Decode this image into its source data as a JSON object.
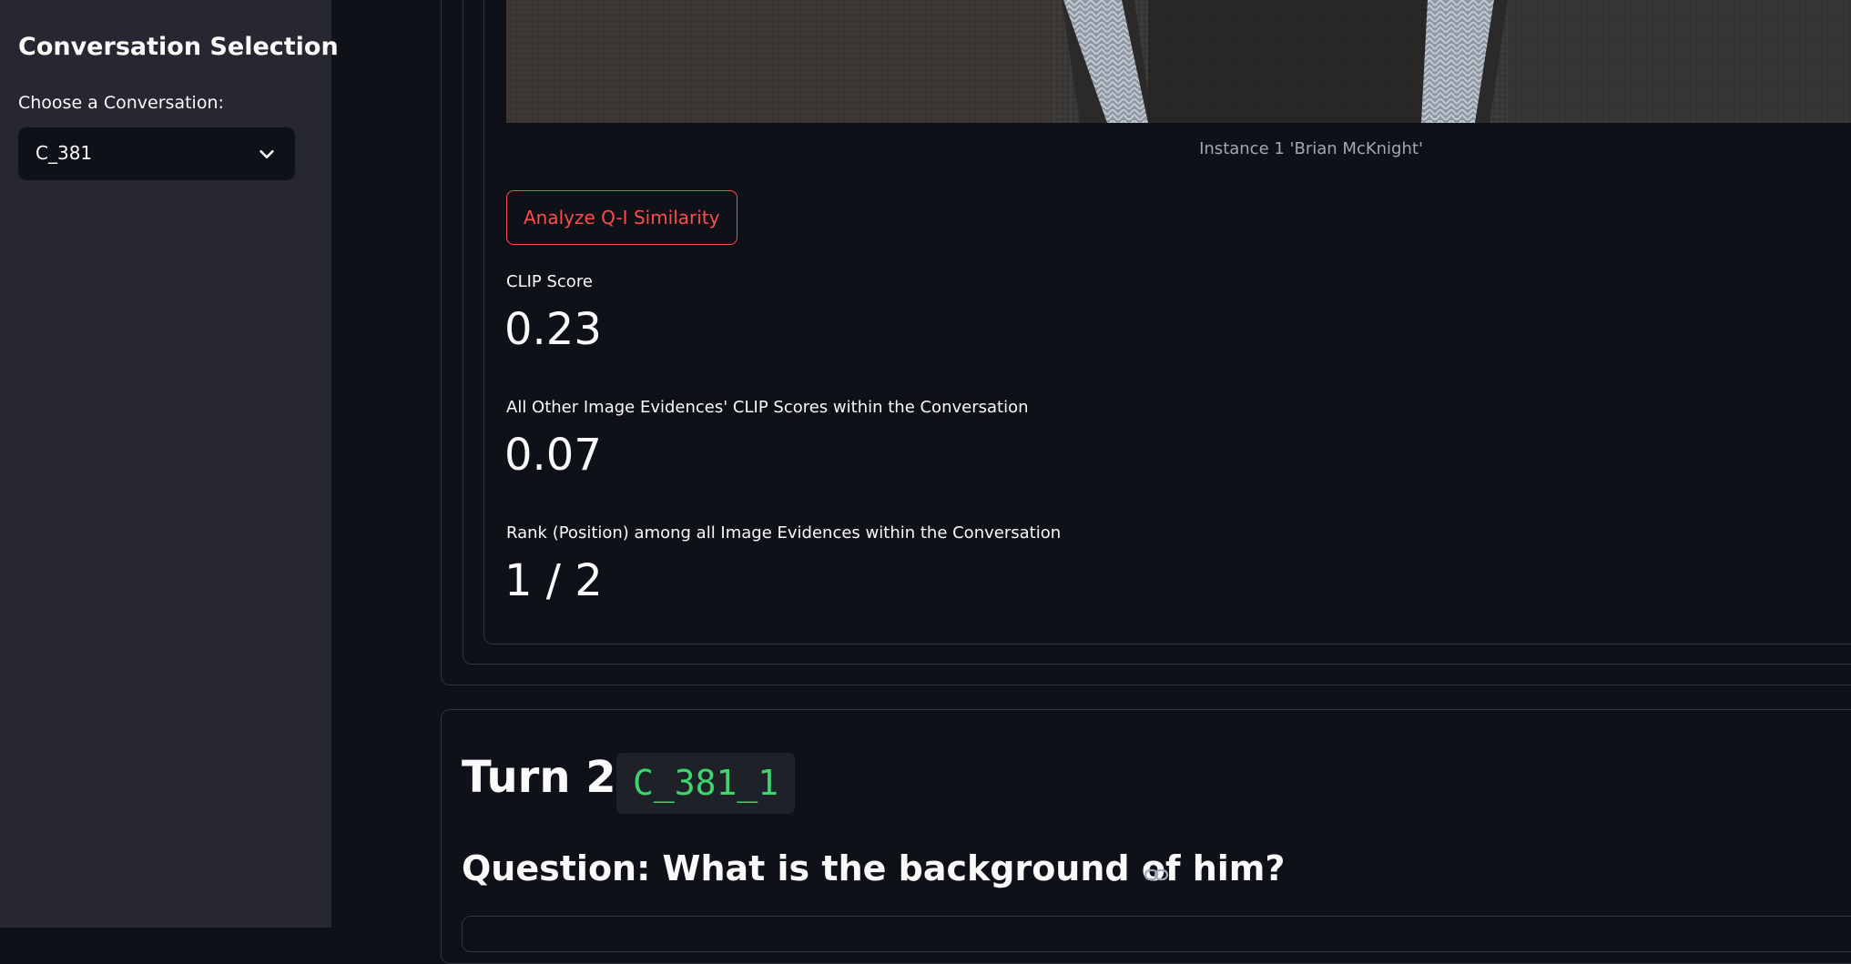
{
  "sidebar": {
    "title": "Conversation Selection",
    "select_label": "Choose a Conversation:",
    "selected_value": "C_381"
  },
  "image_evidence": {
    "caption": "Instance 1 'Brian McKnight'"
  },
  "analyze_button_label": "Analyze Q-I Similarity",
  "metrics": [
    {
      "label": "CLIP Score",
      "value": "0.23"
    },
    {
      "label": "All Other Image Evidences' CLIP Scores within the Conversation",
      "value": "0.07"
    },
    {
      "label": "Rank (Position) among all Image Evidences within the Conversation",
      "value": "1 / 2"
    }
  ],
  "turn": {
    "heading": "Turn 2:",
    "code": "C_381_1",
    "question": "Question: What is the background of him?"
  },
  "colors": {
    "background": "#0e1117",
    "sidebar": "#262730",
    "accent": "#ff4b4b",
    "code_text": "#3dd56d"
  }
}
